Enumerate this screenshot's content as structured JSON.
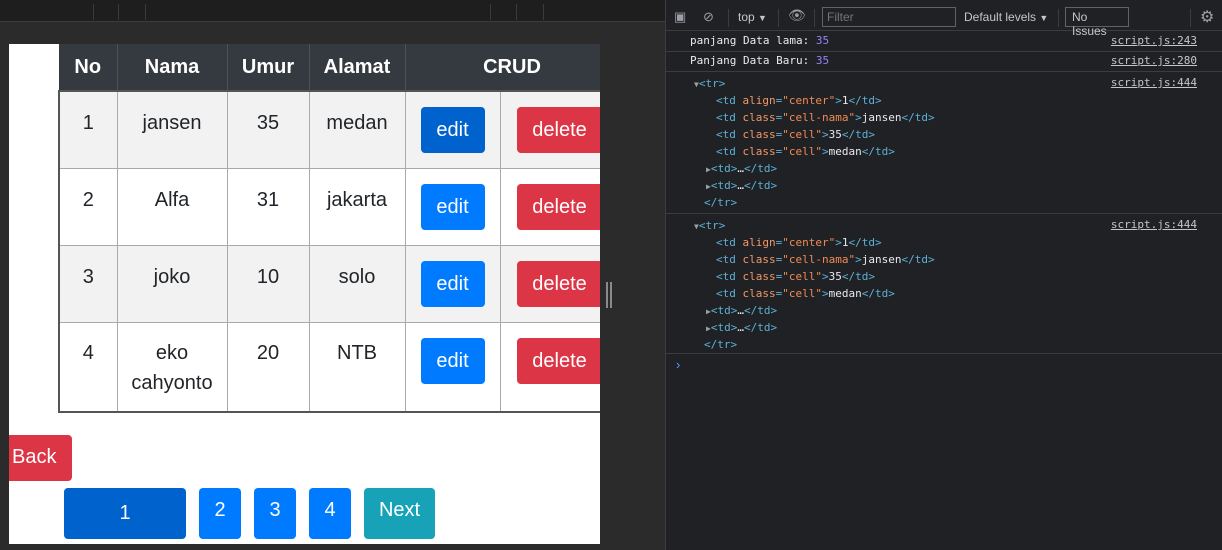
{
  "table": {
    "headers": [
      "No",
      "Nama",
      "Umur",
      "Alamat",
      "CRUD"
    ],
    "rows": [
      {
        "no": "1",
        "nama": "jansen",
        "umur": "35",
        "alamat": "medan"
      },
      {
        "no": "2",
        "nama": "Alfa",
        "umur": "31",
        "alamat": "jakarta"
      },
      {
        "no": "3",
        "nama": "joko",
        "umur": "10",
        "alamat": "solo"
      },
      {
        "no": "4",
        "nama": "eko cahyonto",
        "umur": "20",
        "alamat": "NTB"
      }
    ],
    "edit_label": "edit",
    "delete_label": "delete"
  },
  "back_label": "Back",
  "pagination": {
    "pages": [
      "1",
      "2",
      "3",
      "4"
    ],
    "current": "1",
    "next_label": "Next"
  },
  "devtools": {
    "context": "top",
    "filter_placeholder": "Filter",
    "levels": "Default levels",
    "issues": "No Issues",
    "logs": [
      {
        "label": "panjang Data lama:",
        "value": "35",
        "source": "script.js:243"
      },
      {
        "label": "Panjang Data Baru:",
        "value": "35",
        "source": "script.js:280"
      }
    ],
    "tr_source_1": "script.js:444",
    "tr_source_2": "script.js:444",
    "tr_cells": {
      "align_value": "\"center\"",
      "cell_1": "1",
      "class_nama": "\"cell-nama\"",
      "cell_2": "jansen",
      "class_cell": "\"cell\"",
      "cell_3": "35",
      "cell_4": "medan"
    }
  },
  "colors": {
    "edit_blue": "#007bff",
    "delete_red": "#dc3545",
    "header_dark": "#343a40",
    "next_teal": "#17a2b8"
  }
}
